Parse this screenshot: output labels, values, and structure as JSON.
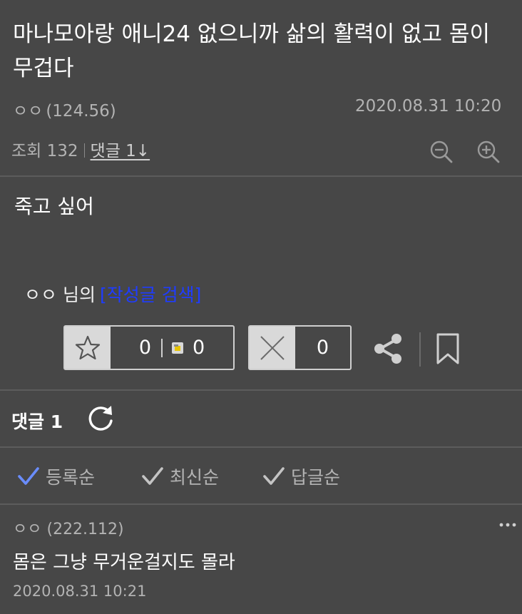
{
  "post": {
    "title": "마나모아랑 애니24 없으니까 삶의 활력이 없고 몸이 무겁다",
    "author": "ㅇㅇ",
    "author_ip": "(124.56)",
    "date": "2020.08.31 10:20",
    "views_label": "조회 132",
    "comments_link": "댓글 1↓",
    "body": "죽고 싶어"
  },
  "author_search": {
    "name": "ㅇㅇ 님의",
    "link": "[작성글 검색]"
  },
  "votes": {
    "recommend": "0",
    "fixed_recommend": "0",
    "dislike": "0"
  },
  "comments": {
    "header": "댓글 1",
    "sort": [
      "등록순",
      "최신순",
      "답글순"
    ],
    "items": [
      {
        "author": "ㅇㅇ",
        "ip": "(222.112)",
        "text": "몸은 그냥 무거운걸지도 몰라",
        "date": "2020.08.31 10:21"
      }
    ]
  },
  "icons": {
    "zoom_out": "zoom-out-icon",
    "zoom_in": "zoom-in-icon",
    "recommend": "star-icon",
    "dislike": "x-icon",
    "share": "share-icon",
    "bookmark": "bookmark-icon",
    "refresh": "refresh-icon",
    "check": "check-icon",
    "more": "more-icon"
  },
  "colors": {
    "background": "#474747",
    "link": "#1f3cff",
    "active_check": "#6a8dff",
    "muted_text": "#b3b3b3"
  }
}
